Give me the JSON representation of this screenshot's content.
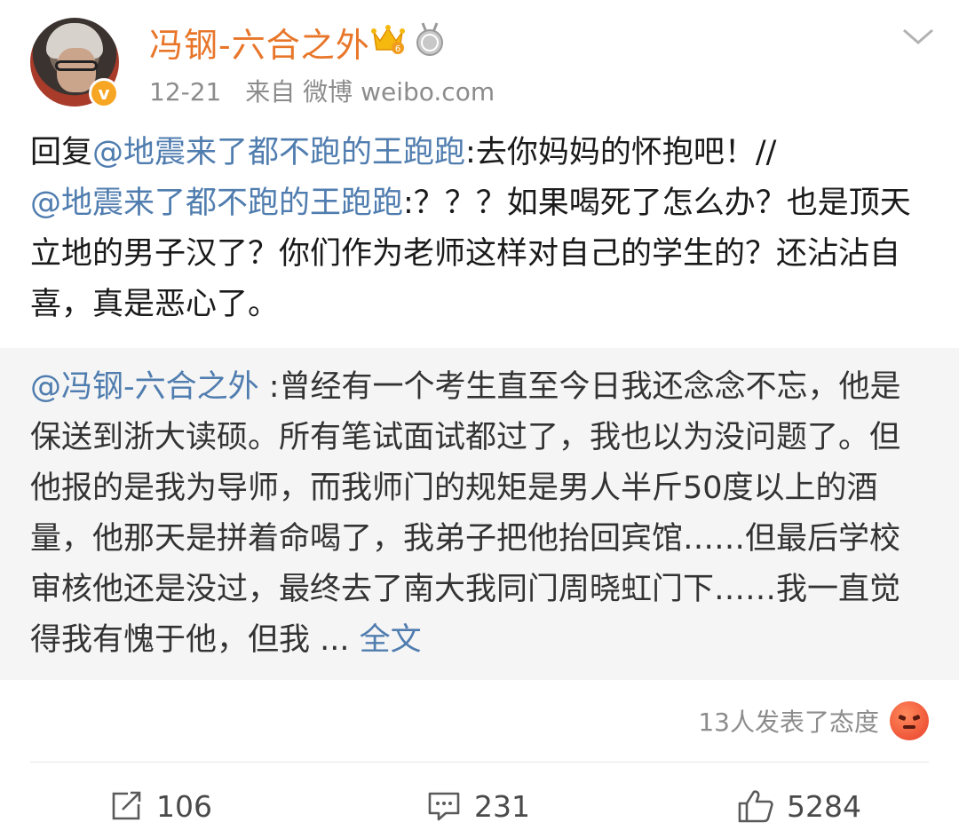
{
  "header": {
    "username": "冯钢-六合之外",
    "date": "12-21",
    "source": "来自 微博 weibo.com",
    "verified_mark": "v"
  },
  "post": {
    "text_parts": [
      {
        "text": "回复",
        "type": "plain"
      },
      {
        "text": "@地震来了都不跑的王跑跑",
        "type": "mention"
      },
      {
        "text": ":去你妈妈的怀抱吧！//",
        "type": "plain"
      },
      {
        "text": "@地震来了都不跑的王跑跑",
        "type": "mention"
      },
      {
        "text": ":？？？如果喝死了怎么办？也是顶天立地的男子汉了？你们作为老师这样对自己的学生的？还沾沾自喜，真是恶心了。",
        "type": "plain"
      }
    ]
  },
  "quote": {
    "mention": "@冯钢-六合之外",
    "body": " :曾经有一个考生直至今日我还念念不忘，他是保送到浙大读硕。所有笔试面试都过了，我也以为没问题了。但他报的是我为导师，而我师门的规矩是男人半斤50度以上的酒量，他那天是拼着命喝了，我弟子把他抬回宾馆……但最后学校审核他还是没过，最终去了南大我同门周晓虹门下……我一直觉得我有愧于他，但我 ... ",
    "more_label": "全文"
  },
  "reactions": {
    "label": "13人发表了态度",
    "emoji": "angry-face-icon"
  },
  "actions": {
    "repost_count": "106",
    "comment_count": "231",
    "like_count": "5284"
  },
  "colors": {
    "username": "#e8762a",
    "mention": "#507daf",
    "quote_bg": "#f5f5f5",
    "meta": "#8c8c8c"
  }
}
